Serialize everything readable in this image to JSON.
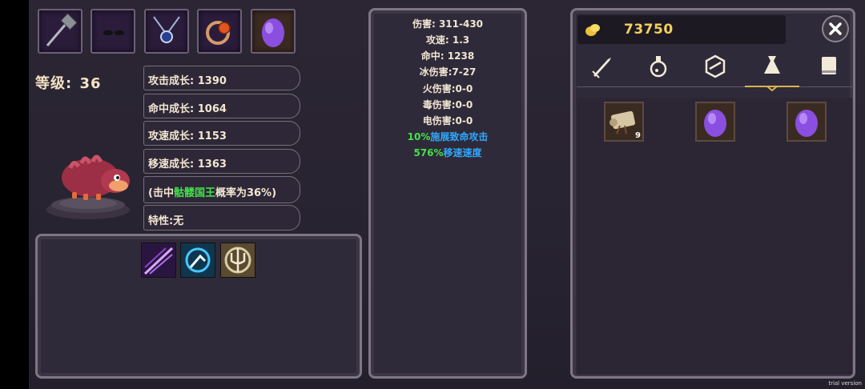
{
  "equipment": {
    "slots": [
      {
        "icon": "warhammer-icon"
      },
      {
        "icon": "dark-glasses-icon"
      },
      {
        "icon": "amulet-icon"
      },
      {
        "icon": "ring-icon"
      },
      {
        "icon": "pet-egg-icon"
      }
    ]
  },
  "character": {
    "level_label": "等级:",
    "level_value": "36"
  },
  "stats": [
    {
      "label": "攻击成长:",
      "value": "1390"
    },
    {
      "label": "命中成长:",
      "value": "1064"
    },
    {
      "label": "攻速成长:",
      "value": "1153"
    },
    {
      "label": "移速成长:",
      "value": "1363"
    }
  ],
  "special": {
    "prefix": "(击中",
    "boss": "骷髅国王",
    "suffix": "概率为36%)"
  },
  "trait": {
    "text": "特性:无"
  },
  "skills": [
    {
      "icon": "slash-skill-icon"
    },
    {
      "icon": "strike-skill-icon"
    },
    {
      "icon": "trident-skill-icon"
    }
  ],
  "attributes": [
    "伤害: 311-430",
    "攻速: 1.3",
    "命中: 1238",
    "冰伤害:7-27",
    "火伤害:0-0",
    "毒伤害:0-0",
    "电伤害:0-0"
  ],
  "bonuses": [
    {
      "value": "10%",
      "label": "施展致命攻击"
    },
    {
      "value": "576%",
      "label": "移速速度"
    }
  ],
  "gold": {
    "value": "73750"
  },
  "tabs": [
    {
      "icon": "sword-icon"
    },
    {
      "icon": "potion-icon"
    },
    {
      "icon": "gem-icon"
    },
    {
      "icon": "bag-icon",
      "active": true
    },
    {
      "icon": "book-icon"
    }
  ],
  "inventory": [
    {
      "icon": "scroll-icon",
      "count": "9"
    },
    {
      "icon": "pet-egg-icon",
      "count": ""
    },
    {
      "icon": "pet-egg-icon",
      "count": ""
    }
  ],
  "watermark": "trial version",
  "colors": {
    "accent_gold": "#f6cf5e",
    "highlight_green": "#43e34a",
    "highlight_blue": "#2ea9ff"
  }
}
